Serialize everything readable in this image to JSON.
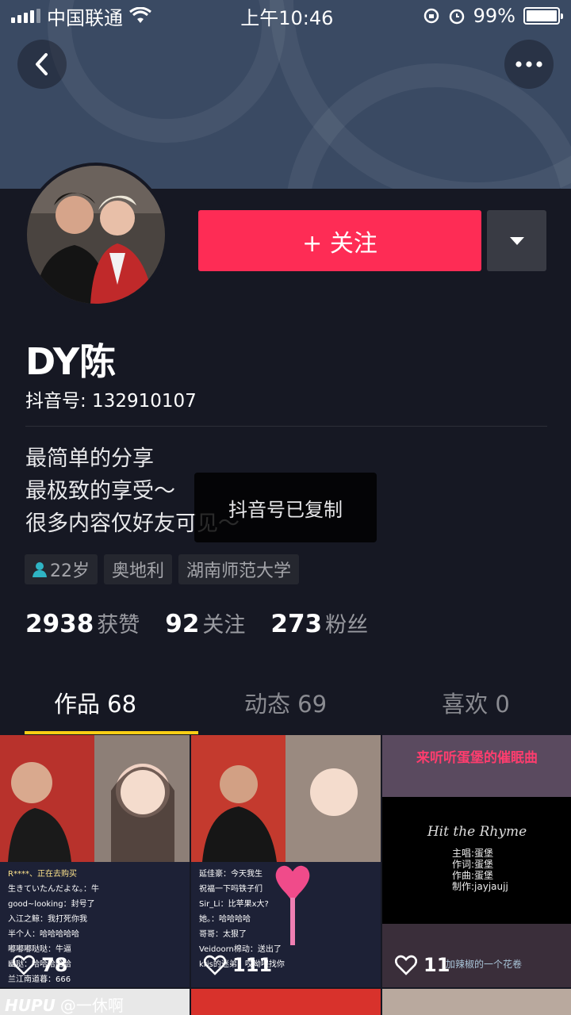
{
  "status_bar": {
    "carrier": "中国联通",
    "time": "上午10:46",
    "battery": "99%",
    "battery_level": 0.99
  },
  "profile": {
    "follow_label": "+ 关注",
    "name": "DY陈",
    "douyin_id": "抖音号: 132910107",
    "bio": [
      "最简单的分享",
      "最极致的享受～",
      "很多内容仅好友可见～"
    ],
    "tags": [
      "22岁",
      "奥地利",
      "湖南师范大学"
    ],
    "stats": [
      {
        "num": "2938",
        "label": "获赞"
      },
      {
        "num": "92",
        "label": "关注"
      },
      {
        "num": "273",
        "label": "粉丝"
      }
    ]
  },
  "toast": "抖音号已复制",
  "tabs": [
    "作品 68",
    "动态 69",
    "喜欢 0"
  ],
  "videos": [
    {
      "likes": "78",
      "comments": [
        "生きていたんだよな。：牛",
        "good~looking：封号了",
        "入江之鲸：我打死你我",
        "半个人：哈哈哈哈哈",
        "嘟嘟嘟哒哒：牛逼",
        "幽哒：哈哈哈哈哈",
        "兰江南道暮：666"
      ],
      "badge": "R****、正在去购买"
    },
    {
      "likes": "111",
      "comments": [
        "延佳豪：今天我生",
        "祝福一下吗铁子们",
        "Sir_Li：比苹果x大?",
        "她。：哈哈哈哈",
        "哥哥：太狠了",
        "Veidoorn棉动：送出了",
        "kris的迷弟：哎呦喂找你"
      ]
    },
    {
      "likes": "11",
      "title": "来听听蛋堡的催眠曲",
      "song": "Hit the Rhyme",
      "credits": [
        "主唱:蛋堡",
        "作词:蛋堡",
        "作曲:蛋堡",
        "制作:jayjaujj"
      ],
      "subtitle": "加辣椒的一个花卷"
    }
  ],
  "watermark": {
    "brand": "HUPU",
    "user": "@一休啊"
  },
  "colors": {
    "accent": "#fe2c55",
    "bg": "#161823",
    "tab_indicator": "#face15"
  }
}
